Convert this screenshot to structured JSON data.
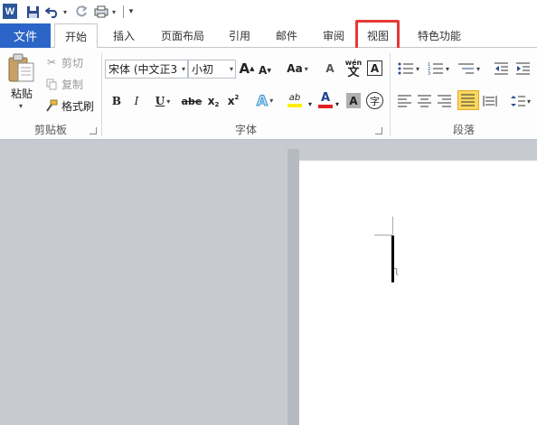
{
  "qat": {
    "logo": "W",
    "more": "▾"
  },
  "tabs": {
    "file": "文件",
    "home": "开始",
    "insert": "插入",
    "layout": "页面布局",
    "references": "引用",
    "mailings": "邮件",
    "review": "审阅",
    "view": "视图",
    "special": "特色功能"
  },
  "clipboard": {
    "paste": "粘贴",
    "cut": "剪切",
    "copy": "复制",
    "format_painter": "格式刷",
    "label": "剪贴板"
  },
  "font": {
    "name": "宋体 (中文正3",
    "size": "小初",
    "grow": "A",
    "shrink": "A",
    "case": "Aa",
    "clear": "A",
    "pinyin_top": "wén",
    "pinyin_char": "文",
    "border_char": "A",
    "bold": "B",
    "italic": "I",
    "underline": "U",
    "strike": "abe",
    "subscript": "x",
    "superscript": "x",
    "effects": "A",
    "highlight": "ab",
    "color": "A",
    "shading": "A",
    "enclose": "字",
    "label": "字体"
  },
  "paragraph": {
    "label": "段落"
  },
  "colors": {
    "file_tab": "#2b65c7",
    "highlight_box": "#e53935",
    "selected": "#fbd85f"
  }
}
